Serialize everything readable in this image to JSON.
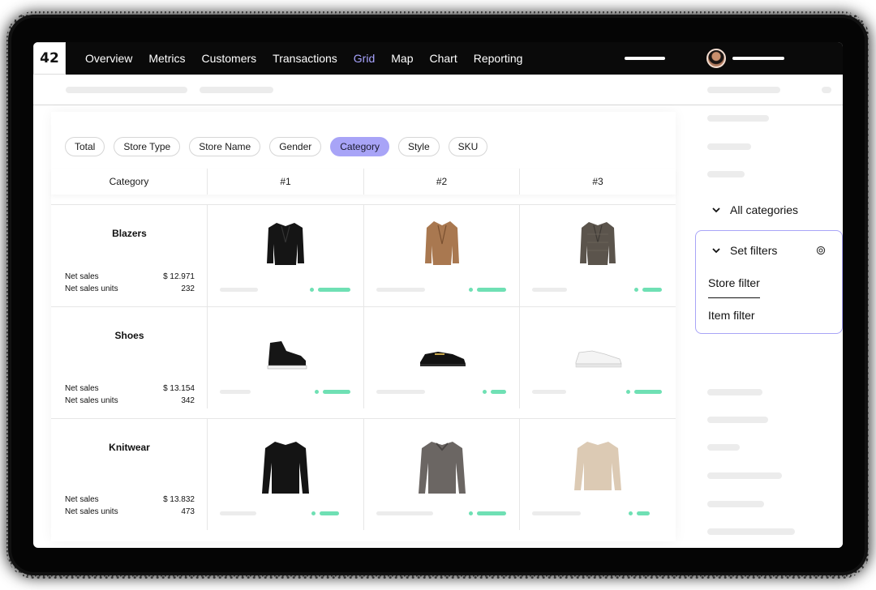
{
  "app": {
    "logo": "42"
  },
  "nav": {
    "items": [
      "Overview",
      "Metrics",
      "Customers",
      "Transactions",
      "Grid",
      "Map",
      "Chart",
      "Reporting"
    ],
    "active_index": 4
  },
  "filters": {
    "chips": [
      "Total",
      "Store Type",
      "Store Name",
      "Gender",
      "Category",
      "Style",
      "SKU"
    ],
    "active_index": 4
  },
  "grid": {
    "headers": [
      "Category",
      "#1",
      "#2",
      "#3"
    ],
    "rows": [
      {
        "category": "Blazers",
        "net_sales_label": "Net sales",
        "net_sales": "$ 12.971",
        "units_label": "Net sales units",
        "units": "232",
        "products": [
          "black-blazer-image",
          "tan-blazer-image",
          "tweed-blazer-image"
        ]
      },
      {
        "category": "Shoes",
        "net_sales_label": "Net sales",
        "net_sales": "$ 13.154",
        "units_label": "Net sales units",
        "units": "342",
        "products": [
          "black-hightop-sneaker-image",
          "black-loafer-image",
          "white-sneaker-image"
        ]
      },
      {
        "category": "Knitwear",
        "net_sales_label": "Net sales",
        "net_sales": "$ 13.832",
        "units_label": "Net sales units",
        "units": "473",
        "products": [
          "black-sweater-image",
          "grey-sweater-image",
          "beige-sweater-image"
        ]
      }
    ]
  },
  "sidebar": {
    "all_categories_label": "All categories",
    "set_filters_label": "Set filters",
    "filter_options": [
      "Store filter",
      "Item filter"
    ],
    "selected_filter_index": 0
  },
  "colors": {
    "accent": "#a8a4f7",
    "nav_active": "#a8a4ff",
    "bar_green": "#6fe0b4",
    "topbar": "#0a0a0a"
  }
}
